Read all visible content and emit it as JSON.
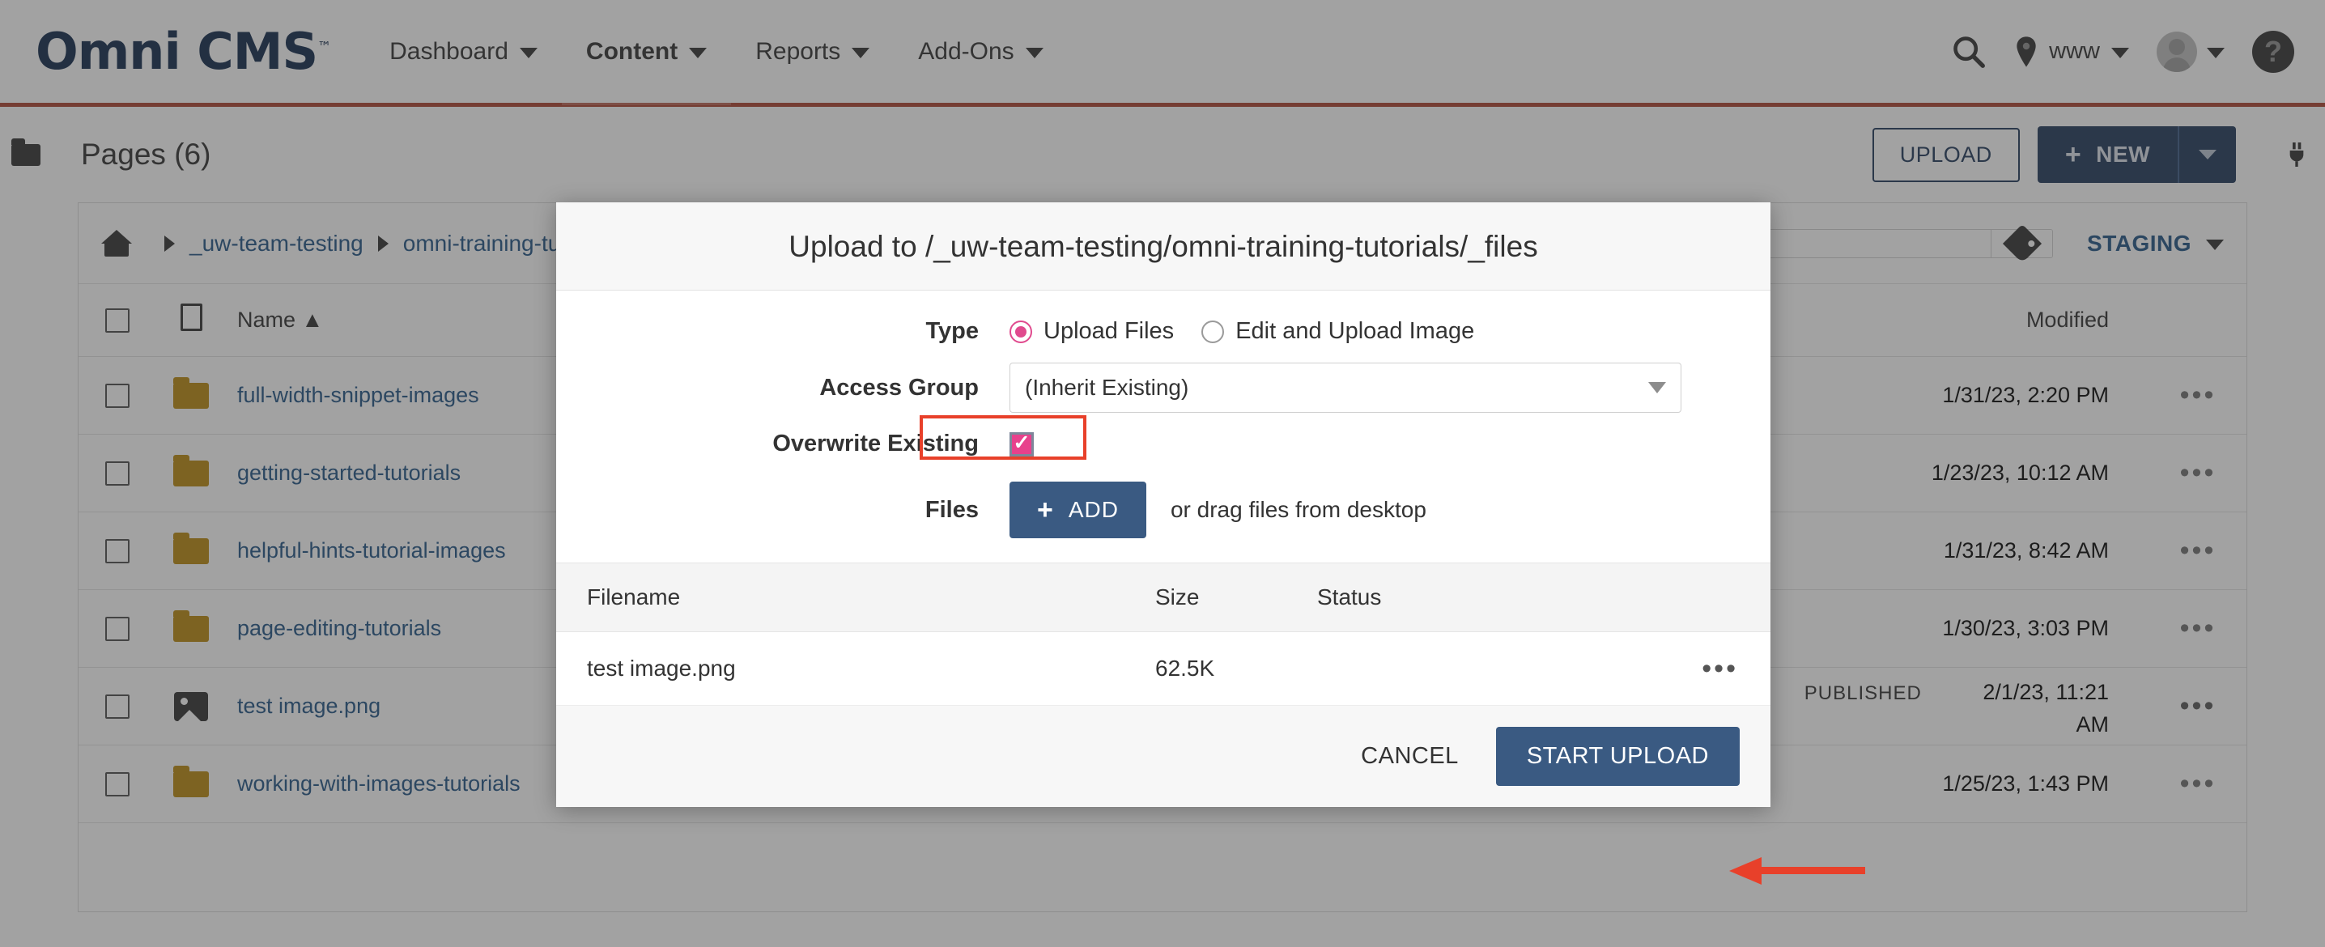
{
  "brand": {
    "name": "Omni CMS",
    "tm": "™",
    "logo_color": "#0d2547",
    "accent_rule": "#a93f2b"
  },
  "topnav": {
    "items": [
      {
        "label": "Dashboard",
        "active": false
      },
      {
        "label": "Content",
        "active": true
      },
      {
        "label": "Reports",
        "active": false
      },
      {
        "label": "Add-Ons",
        "active": false
      }
    ],
    "search_icon": "search-icon",
    "site_label": "www",
    "pin_icon": "location-pin-icon",
    "avatar_icon": "user-avatar",
    "help_icon": "help-question-icon"
  },
  "toolbar": {
    "folder_icon": "folder-icon",
    "page_title": "Pages (6)",
    "upload_label": "UPLOAD",
    "new_label": "NEW",
    "new_plus": "+",
    "plug_icon": "plug-icon"
  },
  "breadcrumb": {
    "home_icon": "home-icon",
    "items": [
      "_uw-team-testing",
      "omni-training-tutorials"
    ],
    "search_placeholder": "",
    "search_value": "",
    "tag_icon": "tag-icon",
    "staging_label": "STAGING"
  },
  "table": {
    "columns": {
      "name": "Name",
      "sort_indicator": "▲",
      "modified": "Modified"
    },
    "rows": [
      {
        "icon": "folder-icon",
        "name": "full-width-snippet-images",
        "status": "",
        "modified": "1/31/23, 2:20 PM"
      },
      {
        "icon": "folder-icon",
        "name": "getting-started-tutorials",
        "status": "",
        "modified": "1/23/23, 10:12 AM"
      },
      {
        "icon": "folder-icon",
        "name": "helpful-hints-tutorial-images",
        "status": "",
        "modified": "1/31/23, 8:42 AM"
      },
      {
        "icon": "folder-icon",
        "name": "page-editing-tutorials",
        "status": "",
        "modified": "1/30/23, 3:03 PM"
      },
      {
        "icon": "image-icon",
        "name": "test image.png",
        "status": "PUBLISHED",
        "modified": "2/1/23, 11:21 AM"
      },
      {
        "icon": "folder-icon",
        "name": "working-with-images-tutorials",
        "status": "",
        "modified": "1/25/23, 1:43 PM"
      }
    ],
    "row_menu": "•••"
  },
  "modal": {
    "title": "Upload to /_uw-team-testing/omni-training-tutorials/_files",
    "type": {
      "label": "Type",
      "options": [
        {
          "label": "Upload Files",
          "selected": true
        },
        {
          "label": "Edit and Upload Image",
          "selected": false
        }
      ]
    },
    "access_group": {
      "label": "Access Group",
      "value": "(Inherit Existing)"
    },
    "overwrite": {
      "label": "Overwrite Existing",
      "checked": true,
      "highlight_color": "#e8402a"
    },
    "files": {
      "label": "Files",
      "add_label": "ADD",
      "add_plus": "+",
      "drag_hint": "or drag files from desktop"
    },
    "filelist": {
      "headers": {
        "filename": "Filename",
        "size": "Size",
        "status": "Status"
      },
      "rows": [
        {
          "filename": "test image.png",
          "size": "62.5K",
          "status": "",
          "menu": "•••"
        }
      ]
    },
    "footer": {
      "cancel_label": "CANCEL",
      "start_label": "START UPLOAD"
    },
    "accent_button_color": "#3a5a82",
    "radio_color": "#e04a8e",
    "checkbox_color": "#e8418c"
  },
  "annotations": {
    "arrow_color": "#e8402a",
    "arrow_target": "start-upload-button"
  }
}
